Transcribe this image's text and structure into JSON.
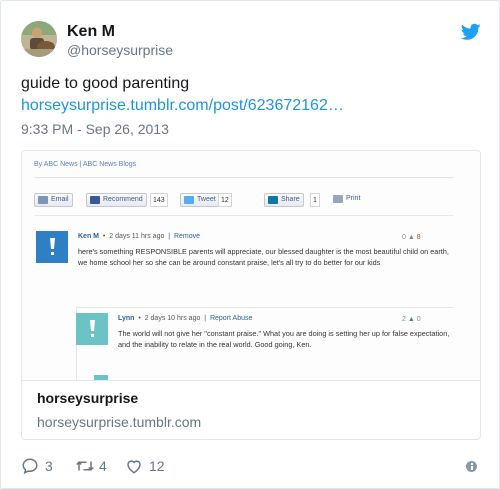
{
  "author": {
    "name": "Ken M",
    "handle": "@horseysurprise"
  },
  "tweet": {
    "text": "guide to good parenting",
    "link": "horseysurprise.tumblr.com/post/623672162…",
    "timestamp": "9:33 PM - Sep 26, 2013"
  },
  "card": {
    "title": "horseysurprise",
    "domain": "horseysurprise.tumblr.com",
    "screenshot": {
      "source": "By ABC News | ABC News Blogs",
      "share": {
        "email": "Email",
        "recommend": "Recommend",
        "recommend_count": "143",
        "tweet": "Tweet",
        "tweet_count": "12",
        "share": "Share",
        "share_count": "1",
        "print": "Print"
      },
      "comments": [
        {
          "name": "Ken M",
          "time": "2 days 11 hrs ago",
          "action": "Remove",
          "up": "0",
          "down": "8",
          "body": "here's something RESPONSIBLE parents will appreciate, our blessed daughter is the most beautiful child on earth, we home school her so she can be around constant praise, let's all try to do better for our kids",
          "avatar_color": "#2f7fc4"
        },
        {
          "name": "Lynn",
          "time": "2 days 10 hrs ago",
          "action": "Report Abuse",
          "up": "2",
          "down": "0",
          "body": "The world will not give her \"constant praise.\" What you are doing is setting her up for false expectation, and the inability to relate in the real world. Good going, Ken.",
          "avatar_color": "#6cc3c6"
        }
      ]
    }
  },
  "actions": {
    "replies": "3",
    "retweets": "4",
    "likes": "12"
  },
  "colors": {
    "twitter_blue": "#1da1f2",
    "link": "#1b95e0",
    "muted": "#657786"
  }
}
